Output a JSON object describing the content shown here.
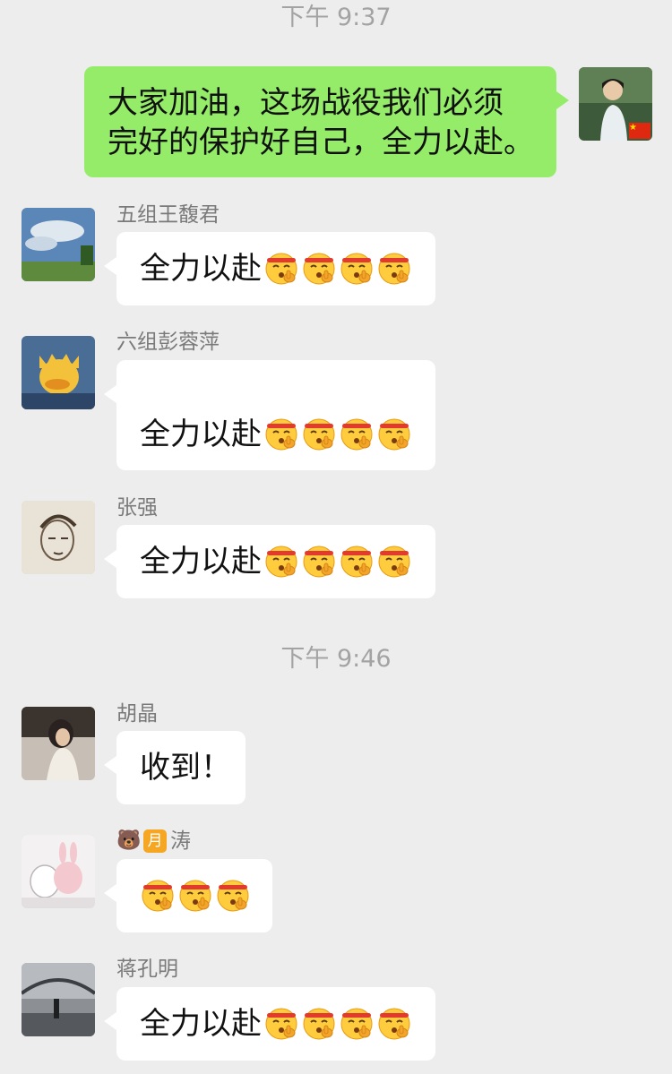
{
  "chat": {
    "timestamps": [
      "下午 9:37",
      "下午 9:46"
    ],
    "emoji_name": "face-with-hand-over-mouth-headband-emoji",
    "messages": [
      {
        "direction": "out",
        "sender": "",
        "lines": [
          "大家加油，这场战役我们必须",
          "完好的保护好自己，全力以赴。"
        ],
        "emoji_count": 0,
        "avatar": "woman-portrait-avatar"
      },
      {
        "direction": "in",
        "sender": "五组王馥君",
        "text": "全力以赴",
        "emoji_count": 4,
        "avatar": "sky-landscape-avatar"
      },
      {
        "direction": "in",
        "sender": "六组彭蓉萍",
        "text": "全力以赴",
        "emoji_count": 4,
        "avatar": "yellow-duck-avatar"
      },
      {
        "direction": "in",
        "sender": "张强",
        "text": "全力以赴",
        "emoji_count": 4,
        "avatar": "sketch-face-avatar"
      },
      {
        "direction": "in",
        "sender": "胡晶",
        "text": "收到！",
        "emoji_count": 0,
        "avatar": "girl-photo-avatar"
      },
      {
        "direction": "in",
        "sender": "涛",
        "sender_badges": [
          "bear-emoji",
          "月"
        ],
        "text": "",
        "emoji_count": 3,
        "avatar": "rabbits-cartoon-avatar"
      },
      {
        "direction": "in",
        "sender": "蒋孔明",
        "text": "全力以赴",
        "emoji_count": 4,
        "avatar": "bridge-photo-avatar"
      }
    ]
  },
  "colors": {
    "background": "#ededed",
    "outgoing_bubble": "#95ec69",
    "incoming_bubble": "#ffffff",
    "timestamp": "#a3a3a3",
    "sender_name": "#7a7a7a"
  }
}
